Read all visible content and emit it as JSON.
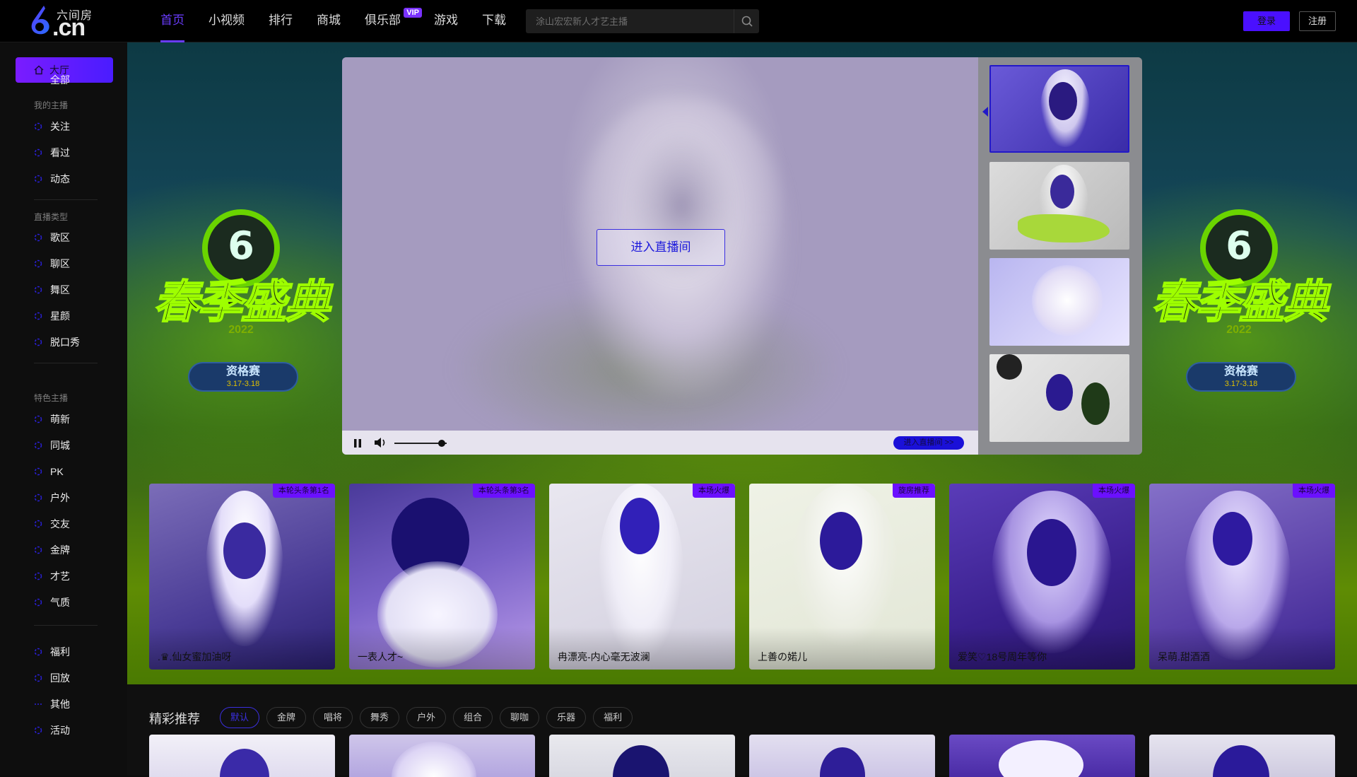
{
  "brand": {
    "name": "六间房",
    "domain": ".cn"
  },
  "nav": [
    {
      "label": "首页",
      "active": true
    },
    {
      "label": "小视频"
    },
    {
      "label": "排行"
    },
    {
      "label": "商城"
    },
    {
      "label": "俱乐部",
      "badge": "VIP"
    },
    {
      "label": "游戏"
    },
    {
      "label": "下载"
    }
  ],
  "search": {
    "placeholder": "涂山宏宏新人才艺主播"
  },
  "auth": {
    "login": "登录",
    "register": "注册"
  },
  "sidebar": {
    "home": "大厅",
    "all": "全部",
    "my_anchor_head": "我的主播",
    "my_anchor": [
      "关注",
      "看过",
      "动态"
    ],
    "live_type_head": "直播类型",
    "live_types": [
      "歌区",
      "聊区",
      "舞区",
      "星颜",
      "脱口秀"
    ],
    "featured_head": "特色主播",
    "featured": [
      "萌新",
      "同城",
      "PK",
      "户外",
      "交友",
      "金牌",
      "才艺",
      "气质"
    ],
    "extras": [
      "福利",
      "回放",
      "其他",
      "活动"
    ]
  },
  "event": {
    "year": "2022",
    "title": "春季盛典",
    "badge_title": "资格赛",
    "badge_date": "3.17-3.18"
  },
  "player": {
    "enter_label": "进入直播间",
    "live_pill": "进入直播间 >>",
    "volume_level": 0.9
  },
  "hot_cards": [
    {
      "tag": "本轮头条第1名",
      "name": ".♛.仙女蜜加油呀"
    },
    {
      "tag": "本轮头条第3名",
      "name": "一表人才~"
    },
    {
      "tag": "本场火爆",
      "name": "冉漂亮-内心毫无波澜"
    },
    {
      "tag": "旋房推荐",
      "name": "上善の婼儿"
    },
    {
      "tag": "本场火爆",
      "name": "爱笑♡18号周年等你"
    },
    {
      "tag": "本场火爆",
      "name": "呆萌.甜酒酒"
    }
  ],
  "recommend": {
    "title": "精彩推荐",
    "chips": [
      {
        "label": "默认",
        "active": true
      },
      {
        "label": "金牌"
      },
      {
        "label": "唱将"
      },
      {
        "label": "舞秀"
      },
      {
        "label": "户外"
      },
      {
        "label": "组合"
      },
      {
        "label": "聊咖"
      },
      {
        "label": "乐器"
      },
      {
        "label": "福利"
      }
    ]
  },
  "colors": {
    "accent": "#6a3cff",
    "vip": "#7a32ff",
    "tag": "#6b10ff",
    "event_green": "#9eff00"
  }
}
